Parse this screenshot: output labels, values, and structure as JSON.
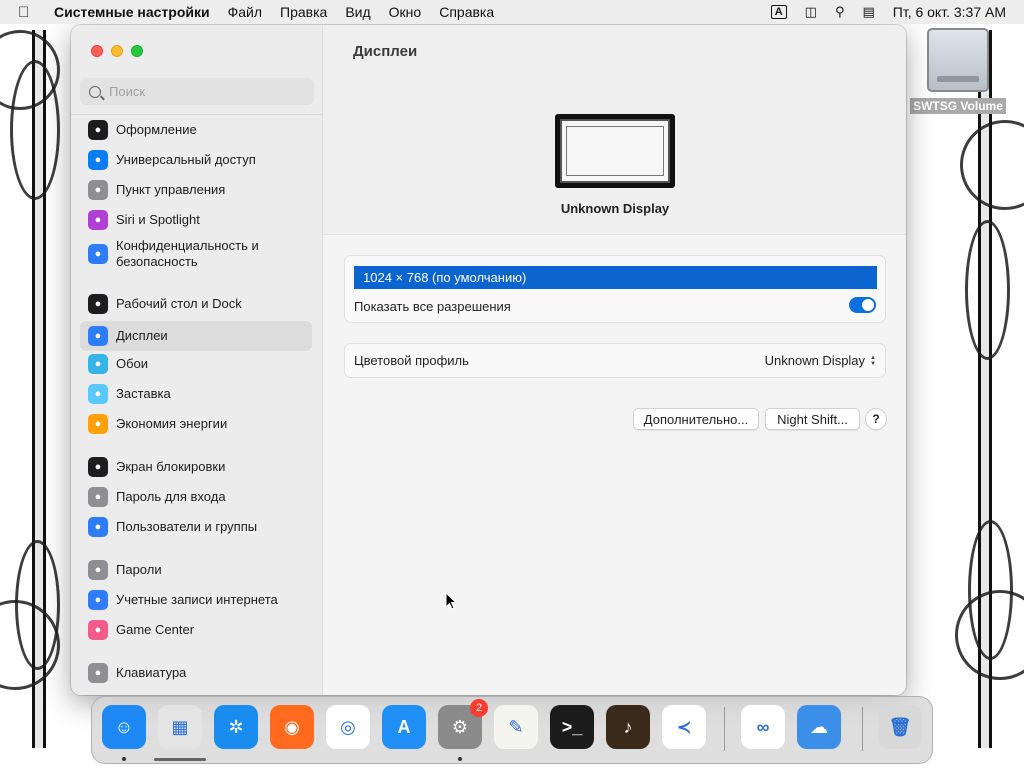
{
  "menubar": {
    "app_name": "Системные настройки",
    "items": [
      "Файл",
      "Правка",
      "Вид",
      "Окно",
      "Справка"
    ],
    "input_source": "A",
    "clock": "Пт, 6 окт.  3:37 AM"
  },
  "desktop": {
    "drive_label": "SWTSG Volume"
  },
  "sidebar": {
    "search_placeholder": "Поиск",
    "items": [
      {
        "label": "Оформление",
        "icon": "appearance-icon",
        "color": "#1d1d1f"
      },
      {
        "label": "Универсальный доступ",
        "icon": "accessibility-icon",
        "color": "#0a7cf2"
      },
      {
        "label": "Пункт управления",
        "icon": "control-center-icon",
        "color": "#8e8e93"
      },
      {
        "label": "Siri и Spotlight",
        "icon": "siri-icon",
        "color": "#b03fd6"
      },
      {
        "label": "Конфиденциальность и безопасность",
        "icon": "privacy-hand-icon",
        "color": "#2e7cf6"
      },
      {
        "label": "Рабочий стол и Dock",
        "icon": "desktop-dock-icon",
        "color": "#1d1d1f"
      },
      {
        "label": "Дисплеи",
        "icon": "displays-icon",
        "color": "#2e7cf6"
      },
      {
        "label": "Обои",
        "icon": "wallpaper-icon",
        "color": "#37b4e8"
      },
      {
        "label": "Заставка",
        "icon": "screensaver-icon",
        "color": "#5ac8fa"
      },
      {
        "label": "Экономия энергии",
        "icon": "energy-icon",
        "color": "#ff9f0a"
      },
      {
        "label": "Экран блокировки",
        "icon": "lock-screen-icon",
        "color": "#1d1d1f"
      },
      {
        "label": "Пароль для входа",
        "icon": "login-password-icon",
        "color": "#8e8e93"
      },
      {
        "label": "Пользователи и группы",
        "icon": "users-icon",
        "color": "#2e7cf6"
      },
      {
        "label": "Пароли",
        "icon": "key-icon",
        "color": "#8e8e93"
      },
      {
        "label": "Учетные записи интернета",
        "icon": "at-icon",
        "color": "#2e7cf6"
      },
      {
        "label": "Game Center",
        "icon": "game-center-icon",
        "color": "#f25c8a"
      },
      {
        "label": "Клавиатура",
        "icon": "keyboard-icon",
        "color": "#8e8e93"
      }
    ],
    "selected_index": 6
  },
  "main": {
    "title": "Дисплеи",
    "display_name": "Unknown Display",
    "resolution_selected": "1024 × 768 (по умолчанию)",
    "show_all_label": "Показать все разрешения",
    "show_all_on": true,
    "color_profile_label": "Цветовой профиль",
    "color_profile_value": "Unknown Display",
    "advanced_button": "Дополнительно...",
    "night_shift_button": "Night Shift...",
    "help_button": "?"
  },
  "dock": {
    "items": [
      {
        "name": "finder-icon",
        "color": "#1e88f5",
        "glyph": "☺"
      },
      {
        "name": "launchpad-icon",
        "color": "#e4e4e4",
        "glyph": "▦"
      },
      {
        "name": "safari-icon",
        "color": "#1a8cf0",
        "glyph": "✲"
      },
      {
        "name": "firefox-icon",
        "color": "#ff6a1f",
        "glyph": "◉"
      },
      {
        "name": "chrome-icon",
        "color": "#ffffff",
        "glyph": "◎"
      },
      {
        "name": "app-store-icon",
        "color": "#1f8ff5",
        "glyph": "A"
      },
      {
        "name": "system-settings-icon",
        "color": "#8a8a8a",
        "glyph": "⚙"
      },
      {
        "name": "textedit-icon",
        "color": "#f5f5f0",
        "glyph": "✎"
      },
      {
        "name": "terminal-icon",
        "color": "#1c1c1c",
        "glyph": ">_"
      },
      {
        "name": "garageband-icon",
        "color": "#3a2a1a",
        "glyph": "♪"
      },
      {
        "name": "vscode-icon",
        "color": "#ffffff",
        "glyph": "≺"
      },
      {
        "name": "visual-studio-icon",
        "color": "#ffffff",
        "glyph": "∞"
      },
      {
        "name": "weather-icon",
        "color": "#3b8fe8",
        "glyph": "☁"
      },
      {
        "name": "trash-icon",
        "color": "#d8d8d8",
        "glyph": "🗑"
      }
    ],
    "settings_badge": "2"
  }
}
